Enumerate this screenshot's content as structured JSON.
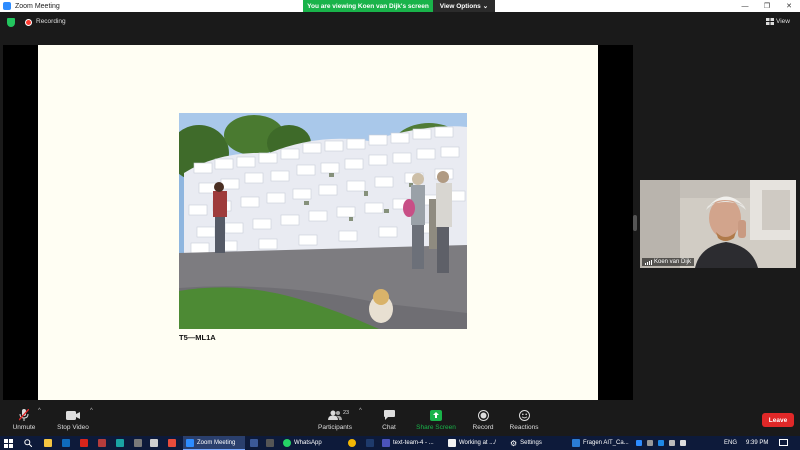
{
  "window": {
    "title": "Zoom Meeting",
    "controls": [
      "—",
      "❐",
      "✕"
    ]
  },
  "banner": {
    "viewing_text": "You are viewing Koen van Dijk's screen",
    "view_options_label": "View Options",
    "view_options_caret": "⌄"
  },
  "topbar": {
    "recording_label": "Recording",
    "view_label": "View"
  },
  "slide": {
    "caption": "T5—ML1A"
  },
  "participant": {
    "name": "Koen van Dijk"
  },
  "toolbar": {
    "unmute_label": "Unmute",
    "stop_video_label": "Stop Video",
    "participants_label": "Participants",
    "participants_count": "23",
    "chat_label": "Chat",
    "share_screen_label": "Share Screen",
    "record_label": "Record",
    "reactions_label": "Reactions",
    "leave_label": "Leave",
    "caret": "^"
  },
  "taskbar": {
    "zoom_label": "Zoom Meeting",
    "whatsapp_label": "WhatsApp",
    "team_label": "text-team-4 - ...",
    "working_label": "Working at .../",
    "settings_label": "Settings",
    "fragen_label": "Fragen AIT_Ca...",
    "lang": "ENG",
    "time": "9:39 PM"
  },
  "colors": {
    "share_green": "#19b34a",
    "leave_red": "#e02828",
    "zoom_blue": "#2d8cff",
    "slide_bg": "#fffef3"
  }
}
